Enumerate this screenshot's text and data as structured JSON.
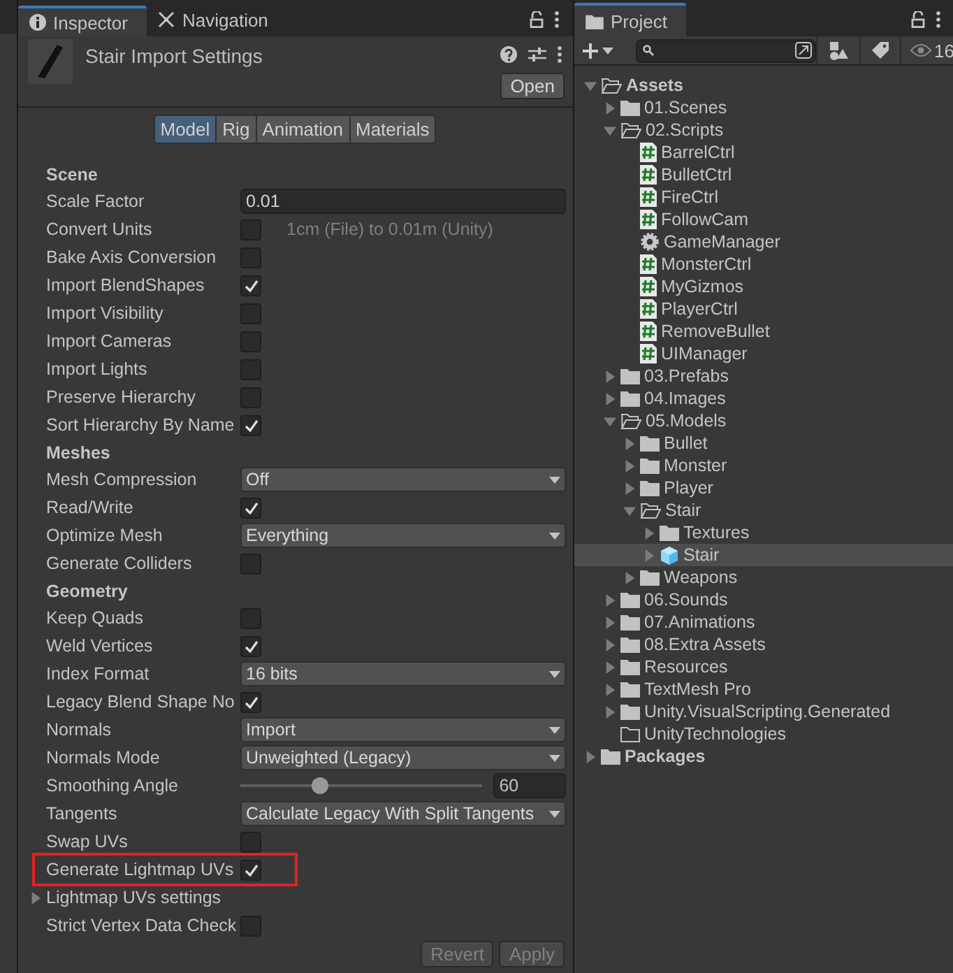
{
  "inspector": {
    "tabs": [
      {
        "label": "Inspector",
        "selected": true
      },
      {
        "label": "Navigation",
        "selected": false
      }
    ],
    "title": "Stair Import Settings",
    "open_button": "Open",
    "subtabs": [
      {
        "label": "Model",
        "selected": true
      },
      {
        "label": "Rig",
        "selected": false
      },
      {
        "label": "Animation",
        "selected": false
      },
      {
        "label": "Materials",
        "selected": false
      }
    ],
    "rows": [
      {
        "kind": "header",
        "label": "Scene"
      },
      {
        "kind": "field",
        "label": "Scale Factor",
        "value": "0.01",
        "highlighted": false
      },
      {
        "kind": "checkbox",
        "label": "Convert Units",
        "checked": false,
        "note": "1cm (File) to 0.01m (Unity)",
        "highlighted": false
      },
      {
        "kind": "checkbox",
        "label": "Bake Axis Conversion",
        "checked": false,
        "highlighted": false
      },
      {
        "kind": "checkbox",
        "label": "Import BlendShapes",
        "checked": true,
        "highlighted": false
      },
      {
        "kind": "checkbox",
        "label": "Import Visibility",
        "checked": false,
        "highlighted": false
      },
      {
        "kind": "checkbox",
        "label": "Import Cameras",
        "checked": false,
        "highlighted": false
      },
      {
        "kind": "checkbox",
        "label": "Import Lights",
        "checked": false,
        "highlighted": false
      },
      {
        "kind": "checkbox",
        "label": "Preserve Hierarchy",
        "checked": false,
        "highlighted": false
      },
      {
        "kind": "checkbox",
        "label": "Sort Hierarchy By Name",
        "checked": true,
        "highlighted": false
      },
      {
        "kind": "header",
        "label": "Meshes"
      },
      {
        "kind": "dropdown",
        "label": "Mesh Compression",
        "value": "Off",
        "highlighted": false
      },
      {
        "kind": "checkbox",
        "label": "Read/Write",
        "checked": true,
        "highlighted": false
      },
      {
        "kind": "dropdown",
        "label": "Optimize Mesh",
        "value": "Everything",
        "highlighted": false
      },
      {
        "kind": "checkbox",
        "label": "Generate Colliders",
        "checked": false,
        "highlighted": false
      },
      {
        "kind": "header",
        "label": "Geometry"
      },
      {
        "kind": "checkbox",
        "label": "Keep Quads",
        "checked": false,
        "highlighted": false
      },
      {
        "kind": "checkbox",
        "label": "Weld Vertices",
        "checked": true,
        "highlighted": false
      },
      {
        "kind": "dropdown",
        "label": "Index Format",
        "value": "16 bits",
        "highlighted": false
      },
      {
        "kind": "checkbox",
        "label": "Legacy Blend Shape No",
        "checked": true,
        "highlighted": false
      },
      {
        "kind": "dropdown",
        "label": "Normals",
        "value": "Import",
        "highlighted": false
      },
      {
        "kind": "dropdown",
        "label": "Normals Mode",
        "value": "Unweighted (Legacy)",
        "highlighted": false
      },
      {
        "kind": "slider",
        "label": "Smoothing Angle",
        "level": 0.33,
        "value": "60",
        "highlighted": false
      },
      {
        "kind": "dropdown",
        "label": "Tangents",
        "value": "Calculate Legacy With Split Tangents",
        "highlighted": false
      },
      {
        "kind": "checkbox",
        "label": "Swap UVs",
        "checked": false,
        "highlighted": false
      },
      {
        "kind": "checkbox",
        "label": "Generate Lightmap UVs",
        "checked": true,
        "highlighted": true
      },
      {
        "kind": "foldout",
        "label": "Lightmap UVs settings",
        "expanded": false
      },
      {
        "kind": "checkbox",
        "label": "Strict Vertex Data Check",
        "checked": false,
        "highlighted": false
      }
    ],
    "buttons": [
      {
        "label": "Revert",
        "disabled": true
      },
      {
        "label": "Apply",
        "disabled": true
      }
    ]
  },
  "project": {
    "tab": "Project",
    "count": "16",
    "tree": [
      {
        "label": "Assets",
        "kind": "folder",
        "bold": true,
        "expanded": true,
        "selected": false,
        "children": [
          {
            "label": "01.Scenes",
            "kind": "folder",
            "expanded": false,
            "selected": false
          },
          {
            "label": "02.Scripts",
            "kind": "folder",
            "expanded": true,
            "selected": false,
            "children": [
              {
                "label": "BarrelCtrl",
                "kind": "script",
                "selected": false
              },
              {
                "label": "BulletCtrl",
                "kind": "script",
                "selected": false
              },
              {
                "label": "FireCtrl",
                "kind": "script",
                "selected": false
              },
              {
                "label": "FollowCam",
                "kind": "script",
                "selected": false
              },
              {
                "label": "GameManager",
                "kind": "gear",
                "selected": false
              },
              {
                "label": "MonsterCtrl",
                "kind": "script",
                "selected": false
              },
              {
                "label": "MyGizmos",
                "kind": "script",
                "selected": false
              },
              {
                "label": "PlayerCtrl",
                "kind": "script",
                "selected": false
              },
              {
                "label": "RemoveBullet",
                "kind": "script",
                "selected": false
              },
              {
                "label": "UIManager",
                "kind": "script",
                "selected": false
              }
            ]
          },
          {
            "label": "03.Prefabs",
            "kind": "folder",
            "expanded": false,
            "selected": false
          },
          {
            "label": "04.Images",
            "kind": "folder",
            "expanded": false,
            "selected": false
          },
          {
            "label": "05.Models",
            "kind": "folder",
            "expanded": true,
            "selected": false,
            "children": [
              {
                "label": "Bullet",
                "kind": "folder",
                "expanded": false,
                "selected": false
              },
              {
                "label": "Monster",
                "kind": "folder",
                "expanded": false,
                "selected": false
              },
              {
                "label": "Player",
                "kind": "folder",
                "expanded": false,
                "selected": false
              },
              {
                "label": "Stair",
                "kind": "folder",
                "expanded": true,
                "selected": false,
                "children": [
                  {
                    "label": "Textures",
                    "kind": "folder",
                    "expanded": false,
                    "selected": false
                  },
                  {
                    "label": "Stair",
                    "kind": "model",
                    "expanded": false,
                    "selected": true
                  }
                ]
              },
              {
                "label": "Weapons",
                "kind": "folder",
                "expanded": false,
                "selected": false
              }
            ]
          },
          {
            "label": "06.Sounds",
            "kind": "folder",
            "expanded": false,
            "selected": false
          },
          {
            "label": "07.Animations",
            "kind": "folder",
            "expanded": false,
            "selected": false
          },
          {
            "label": "08.Extra Assets",
            "kind": "folder",
            "expanded": false,
            "selected": false
          },
          {
            "label": "Resources",
            "kind": "folder",
            "expanded": false,
            "selected": false
          },
          {
            "label": "TextMesh Pro",
            "kind": "folder",
            "expanded": false,
            "selected": false
          },
          {
            "label": "Unity.VisualScripting.Generated",
            "kind": "folder",
            "expanded": false,
            "selected": false
          },
          {
            "label": "UnityTechnologies",
            "kind": "empty-folder",
            "selected": false
          }
        ]
      },
      {
        "label": "Packages",
        "kind": "folder",
        "bold": true,
        "expanded": false,
        "selected": false
      }
    ]
  }
}
